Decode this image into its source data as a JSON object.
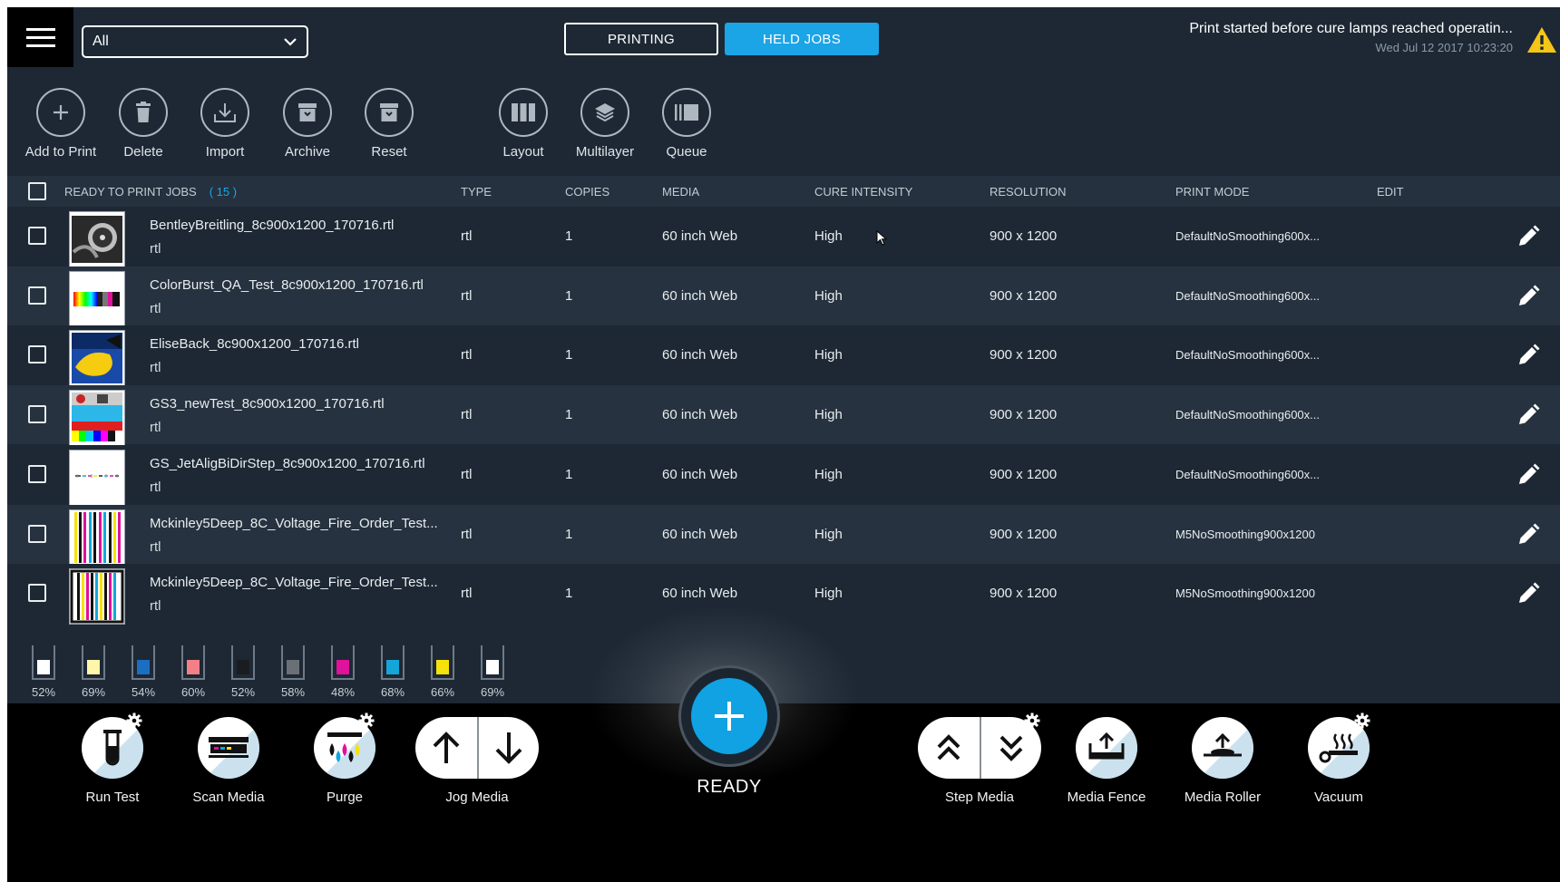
{
  "header": {
    "filter_value": "All",
    "tabs": [
      {
        "label": "PRINTING"
      },
      {
        "label": "HELD JOBS"
      }
    ],
    "active_tab": "HELD JOBS",
    "alert_message": "Print started before cure lamps reached operatin...",
    "alert_time": "Wed Jul 12 2017  10:23:20"
  },
  "toolbar": {
    "add_to_print": "Add to Print",
    "delete": "Delete",
    "import": "Import",
    "archive": "Archive",
    "reset": "Reset",
    "layout": "Layout",
    "multilayer": "Multilayer",
    "queue": "Queue"
  },
  "table": {
    "title": "READY TO PRINT JOBS",
    "count": "( 15 )",
    "columns": {
      "type": "TYPE",
      "copies": "COPIES",
      "media": "MEDIA",
      "cure": "CURE INTENSITY",
      "resolution": "RESOLUTION",
      "print_mode": "PRINT MODE",
      "edit": "EDIT"
    },
    "rows": [
      {
        "name": "BentleyBreitling_8c900x1200_170716.rtl",
        "sub": "rtl",
        "type": "rtl",
        "copies": "1",
        "media": "60 inch Web",
        "cure": "High",
        "resolution": "900 x 1200",
        "print_mode": "DefaultNoSmoothing600x..."
      },
      {
        "name": "ColorBurst_QA_Test_8c900x1200_170716.rtl",
        "sub": "rtl",
        "type": "rtl",
        "copies": "1",
        "media": "60 inch Web",
        "cure": "High",
        "resolution": "900 x 1200",
        "print_mode": "DefaultNoSmoothing600x..."
      },
      {
        "name": "EliseBack_8c900x1200_170716.rtl",
        "sub": "rtl",
        "type": "rtl",
        "copies": "1",
        "media": "60 inch Web",
        "cure": "High",
        "resolution": "900 x 1200",
        "print_mode": "DefaultNoSmoothing600x..."
      },
      {
        "name": "GS3_newTest_8c900x1200_170716.rtl",
        "sub": "rtl",
        "type": "rtl",
        "copies": "1",
        "media": "60 inch Web",
        "cure": "High",
        "resolution": "900 x 1200",
        "print_mode": "DefaultNoSmoothing600x..."
      },
      {
        "name": "GS_JetAligBiDirStep_8c900x1200_170716.rtl",
        "sub": "rtl",
        "type": "rtl",
        "copies": "1",
        "media": "60 inch Web",
        "cure": "High",
        "resolution": "900 x 1200",
        "print_mode": "DefaultNoSmoothing600x..."
      },
      {
        "name": "Mckinley5Deep_8C_Voltage_Fire_Order_Test...",
        "sub": "rtl",
        "type": "rtl",
        "copies": "1",
        "media": "60 inch Web",
        "cure": "High",
        "resolution": "900 x 1200",
        "print_mode": "M5NoSmoothing900x1200"
      },
      {
        "name": "Mckinley5Deep_8C_Voltage_Fire_Order_Test...",
        "sub": "rtl",
        "type": "rtl",
        "copies": "1",
        "media": "60 inch Web",
        "cure": "High",
        "resolution": "900 x 1200",
        "print_mode": "M5NoSmoothing900x1200"
      }
    ]
  },
  "ink_levels": [
    {
      "color": "#ffffff",
      "pct": "52%"
    },
    {
      "color": "#fff6a8",
      "pct": "69%"
    },
    {
      "color": "#1b6fc2",
      "pct": "54%"
    },
    {
      "color": "#f47f86",
      "pct": "60%"
    },
    {
      "color": "#1a1d20",
      "pct": "52%"
    },
    {
      "color": "#6b7077",
      "pct": "58%"
    },
    {
      "color": "#e0119a",
      "pct": "48%"
    },
    {
      "color": "#14a6d8",
      "pct": "68%"
    },
    {
      "color": "#f5e20b",
      "pct": "66%"
    },
    {
      "color": "#ffffff",
      "pct": "69%"
    }
  ],
  "bottom": {
    "run_test": "Run Test",
    "scan_media": "Scan Media",
    "purge": "Purge",
    "jog_media": "Jog Media",
    "status": "READY",
    "step_media": "Step Media",
    "media_fence": "Media Fence",
    "media_roller": "Media Roller",
    "vacuum": "Vacuum"
  },
  "colors": {
    "accent": "#1ba4e6",
    "background": "#1d2834",
    "row_alt": "#26323f",
    "warning": "#f5c518"
  },
  "icons": [
    "menu-icon",
    "chevron-down-icon",
    "warning-icon",
    "plus-icon",
    "trash-icon",
    "import-icon",
    "archive-icon",
    "reset-icon",
    "layout-icon",
    "layers-icon",
    "queue-icon",
    "pencil-icon",
    "gear-icon",
    "test-tube-icon",
    "scan-icon",
    "ink-drops-icon",
    "arrow-up-icon",
    "arrow-down-icon",
    "double-chevron-up-icon",
    "double-chevron-down-icon",
    "media-fence-icon",
    "media-roller-icon",
    "vacuum-icon"
  ]
}
